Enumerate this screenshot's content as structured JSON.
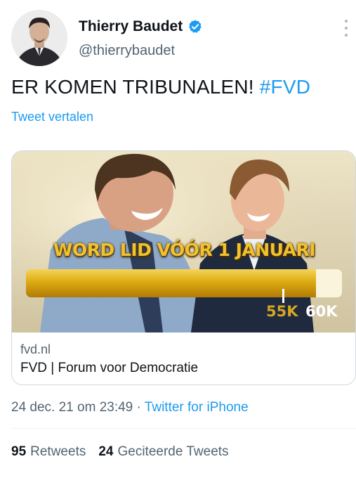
{
  "author": {
    "name": "Thierry Baudet",
    "handle": "@thierrybaudet",
    "verified": true,
    "avatar_icon": "profile-photo"
  },
  "tweet": {
    "text": "ER KOMEN TRIBUNALEN!",
    "hashtag": "#FVD",
    "translate_label": "Tweet vertalen"
  },
  "card": {
    "image": {
      "banner_text": "WORD LID VÓÓR 1 JANUARI",
      "progress_current_label": "55K",
      "progress_target_label": "60K",
      "progress_fraction": 0.917
    },
    "domain": "fvd.nl",
    "title": "FVD | Forum voor Democratie"
  },
  "meta": {
    "timestamp": "24 dec. 21 om 23:49",
    "separator": " · ",
    "source": "Twitter for iPhone"
  },
  "stats": {
    "retweets_count": "95",
    "retweets_label": "Retweets",
    "quotes_count": "24",
    "quotes_label": "Geciteerde Tweets"
  },
  "colors": {
    "accent": "#1d9bf0",
    "secondary_text": "#536471",
    "banner_gold": "#f2c12e"
  }
}
